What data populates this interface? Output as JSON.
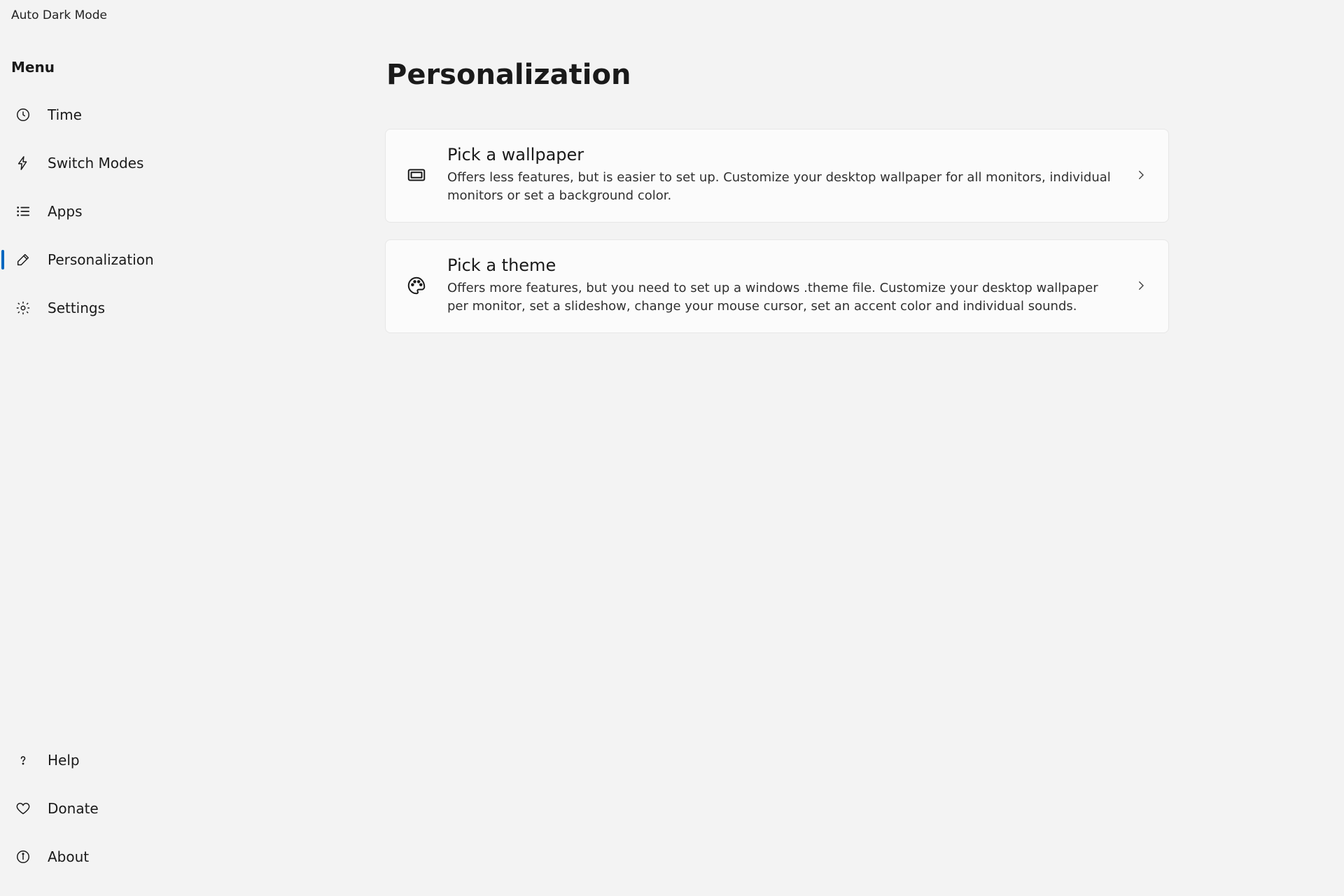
{
  "window": {
    "title": "Auto Dark Mode"
  },
  "sidebar": {
    "heading": "Menu",
    "nav": [
      {
        "label": "Time"
      },
      {
        "label": "Switch Modes"
      },
      {
        "label": "Apps"
      },
      {
        "label": "Personalization"
      },
      {
        "label": "Settings"
      }
    ],
    "bottom": [
      {
        "label": "Help"
      },
      {
        "label": "Donate"
      },
      {
        "label": "About"
      }
    ]
  },
  "page": {
    "title": "Personalization",
    "cards": [
      {
        "title": "Pick a wallpaper",
        "desc": "Offers less features, but is easier to set up. Customize your desktop wallpaper for all monitors, individual monitors or set a background color."
      },
      {
        "title": "Pick a theme",
        "desc": "Offers more features, but you need to set up a windows .theme file. Customize your desktop wallpaper per monitor, set a slideshow, change your mouse cursor, set an accent color and individual sounds."
      }
    ]
  }
}
